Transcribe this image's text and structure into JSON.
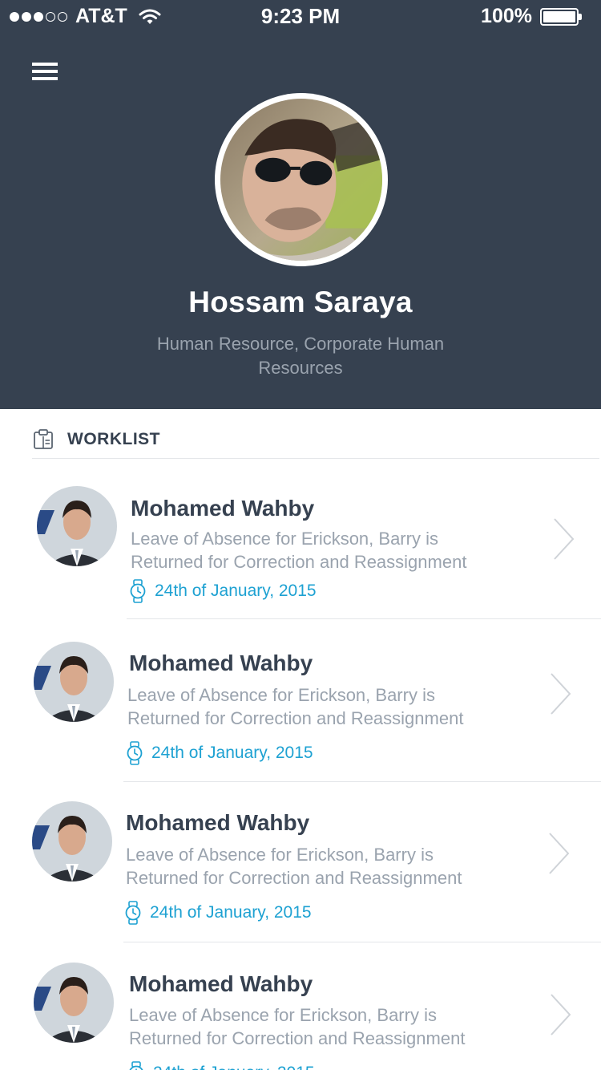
{
  "status_bar": {
    "carrier": "AT&T",
    "time": "9:23 PM",
    "battery": "100%"
  },
  "profile": {
    "name": "Hossam Saraya",
    "role": "Human Resource, Corporate Human Resources"
  },
  "worklist": {
    "title": "WORKLIST",
    "items": [
      {
        "name": "Mohamed Wahby",
        "description": "Leave of Absence for Erickson, Barry is Returned for Correction and Reassignment",
        "date": "24th of January, 2015"
      },
      {
        "name": "Mohamed Wahby",
        "description": "Leave of Absence for Erickson, Barry is Returned for Correction and Reassignment",
        "date": "24th of January, 2015"
      },
      {
        "name": "Mohamed Wahby",
        "description": "Leave of Absence for Erickson, Barry is Returned for Correction and Reassignment",
        "date": "24th of January, 2015"
      },
      {
        "name": "Mohamed Wahby",
        "description": "Leave of Absence for Erickson, Barry is Returned for Correction and Reassignment",
        "date": "24th of January, 2015"
      }
    ]
  },
  "colors": {
    "header_bg": "#364150",
    "accent": "#1da1d2",
    "muted_text": "#9aa3ae"
  },
  "icons": {
    "menu": "hamburger-menu-icon",
    "worklist": "clipboard-icon",
    "date": "watch-icon",
    "item_action": "chevron-right-icon"
  }
}
